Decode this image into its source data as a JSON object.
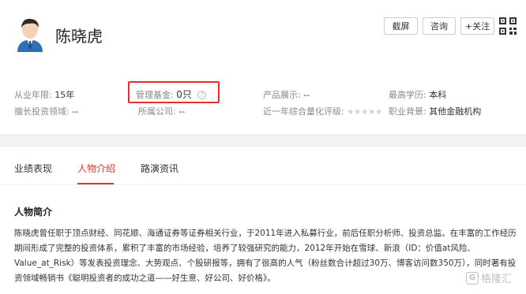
{
  "profile": {
    "name": "陈晓虎"
  },
  "actions": {
    "screenshot": "截屏",
    "consult": "咨询",
    "follow": "+关注"
  },
  "info": {
    "years_label": "从业年限:",
    "years_value": "15年",
    "fund_label": "管理基金:",
    "fund_value": "0只",
    "product_label": "产品展示:",
    "product_value": "--",
    "edu_label": "最高学历:",
    "edu_value": "本科",
    "field_label": "擅长投资领域:",
    "field_value": "--",
    "company_label": "所属公司:",
    "company_value": "--",
    "rating_label": "近一年综合量化评级:",
    "rating_stars": "★★★★★",
    "background_label": "职业背景:",
    "background_value": "其他金融机构",
    "help_glyph": "?"
  },
  "tabs": [
    {
      "label": "业绩表现"
    },
    {
      "label": "人物介绍"
    },
    {
      "label": "路演资讯"
    }
  ],
  "intro": {
    "title": "人物简介",
    "text": "陈晓虎曾任职于顶点财经、同花顺、海通证券等证券相关行业，于2011年进入私募行业，前后任职分析师、投资总监。在丰富的工作经历期间形成了完整的投资体系，累积了丰富的市场经验，培养了较强研究的能力，2012年开始在雪球、新浪（ID：价值at风险、Value_at_Risk）等发表投资理念、大势观点、个股研报等，拥有了很高的人气（粉丝数合计超过30万、博客访问数350万），同时著有投资领域畅销书《聪明投资者的成功之道——好生意、好公司、好价格》。"
  },
  "watermark": {
    "icon": "G",
    "text": "格隆汇"
  },
  "colors": {
    "accent": "#e4322b"
  }
}
